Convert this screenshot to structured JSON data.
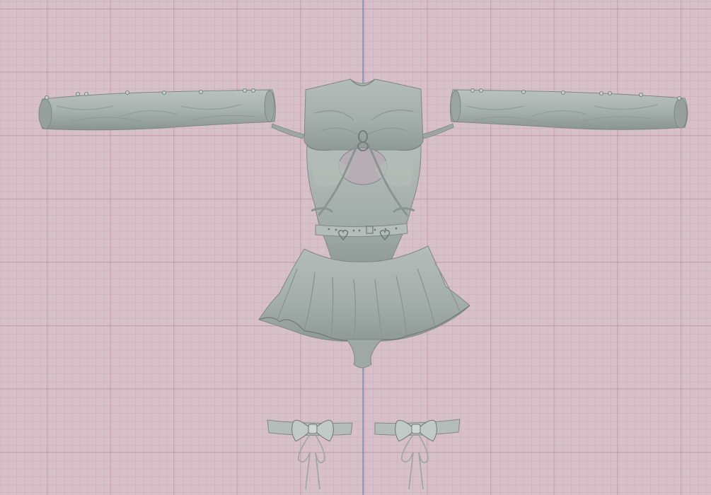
{
  "viewport": {
    "background_color": "#d8c0c8",
    "grid_minor_color": "#c9abb6",
    "grid_major_color": "#b48f9d",
    "axis_color": "#5f86c8",
    "model_color": "#a7b1ad",
    "model_shadow_color": "#7e8884",
    "model_highlight_color": "#c9d0cd"
  },
  "model": {
    "parts": [
      {
        "name": "left-sleeve"
      },
      {
        "name": "right-sleeve"
      },
      {
        "name": "top-with-harness"
      },
      {
        "name": "belt-with-heart-rings"
      },
      {
        "name": "ruffled-skirt"
      },
      {
        "name": "left-bow-garter"
      },
      {
        "name": "right-bow-garter"
      }
    ]
  }
}
